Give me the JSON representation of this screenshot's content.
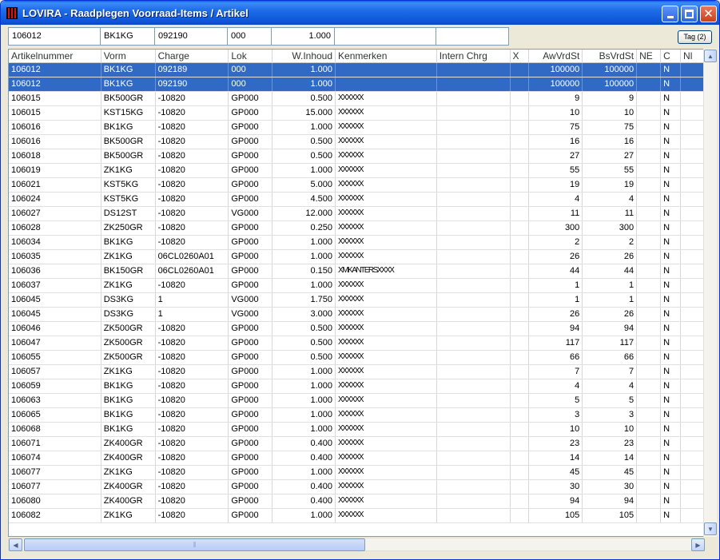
{
  "window": {
    "title": "LOVIRA - Raadplegen Voorraad-Items / Artikel"
  },
  "fields": [
    "106012",
    "BK1KG",
    "092190",
    "000",
    "1.000",
    "",
    ""
  ],
  "tag_button": "Tag (2)",
  "grid": {
    "columns": [
      {
        "key": "art",
        "label": "Artikelnummer",
        "align": "l"
      },
      {
        "key": "vorm",
        "label": "Vorm",
        "align": "l"
      },
      {
        "key": "charge",
        "label": "Charge",
        "align": "l"
      },
      {
        "key": "lok",
        "label": "Lok",
        "align": "l"
      },
      {
        "key": "wi",
        "label": "W.Inhoud",
        "align": "r"
      },
      {
        "key": "kenm",
        "label": "Kenmerken",
        "align": "l"
      },
      {
        "key": "ic",
        "label": "Intern Chrg",
        "align": "l"
      },
      {
        "key": "x",
        "label": "X",
        "align": "l"
      },
      {
        "key": "aw",
        "label": "AwVrdSt",
        "align": "r"
      },
      {
        "key": "bs",
        "label": "BsVrdSt",
        "align": "r"
      },
      {
        "key": "ne",
        "label": "NE",
        "align": "l"
      },
      {
        "key": "c",
        "label": "C",
        "align": "l"
      },
      {
        "key": "nl",
        "label": "Nl",
        "align": "l"
      }
    ],
    "rows": [
      [
        "106012",
        "BK1KG",
        "092189",
        "000",
        "1.000",
        "",
        "",
        "",
        "100000",
        "100000",
        "",
        "N",
        ""
      ],
      [
        "106012",
        "BK1KG",
        "092190",
        "000",
        "1.000",
        "",
        "",
        "",
        "100000",
        "100000",
        "",
        "N",
        ""
      ],
      [
        "106015",
        "BK500GR",
        "-10820",
        "GP000",
        "0.500",
        "XXXXXX",
        "",
        "",
        "9",
        "9",
        "",
        "N",
        ""
      ],
      [
        "106015",
        "KST15KG",
        "-10820",
        "GP000",
        "15.000",
        "XXXXXX",
        "",
        "",
        "10",
        "10",
        "",
        "N",
        ""
      ],
      [
        "106016",
        "BK1KG",
        "-10820",
        "GP000",
        "1.000",
        "XXXXXX",
        "",
        "",
        "75",
        "75",
        "",
        "N",
        ""
      ],
      [
        "106016",
        "BK500GR",
        "-10820",
        "GP000",
        "0.500",
        "XXXXXX",
        "",
        "",
        "16",
        "16",
        "",
        "N",
        ""
      ],
      [
        "106018",
        "BK500GR",
        "-10820",
        "GP000",
        "0.500",
        "XXXXXX",
        "",
        "",
        "27",
        "27",
        "",
        "N",
        ""
      ],
      [
        "106019",
        "ZK1KG",
        "-10820",
        "GP000",
        "1.000",
        "XXXXXX",
        "",
        "",
        "55",
        "55",
        "",
        "N",
        ""
      ],
      [
        "106021",
        "KST5KG",
        "-10820",
        "GP000",
        "5.000",
        "XXXXXX",
        "",
        "",
        "19",
        "19",
        "",
        "N",
        ""
      ],
      [
        "106024",
        "KST5KG",
        "-10820",
        "GP000",
        "4.500",
        "XXXXXX",
        "",
        "",
        "4",
        "4",
        "",
        "N",
        ""
      ],
      [
        "106027",
        "DS12ST",
        "-10820",
        "VG000",
        "12.000",
        "XXXXXX",
        "",
        "",
        "11",
        "11",
        "",
        "N",
        ""
      ],
      [
        "106028",
        "ZK250GR",
        "-10820",
        "GP000",
        "0.250",
        "XXXXXX",
        "",
        "",
        "300",
        "300",
        "",
        "N",
        ""
      ],
      [
        "106034",
        "BK1KG",
        "-10820",
        "GP000",
        "1.000",
        "XXXXXX",
        "",
        "",
        "2",
        "2",
        "",
        "N",
        ""
      ],
      [
        "106035",
        "ZK1KG",
        "06CL0260A01",
        "GP000",
        "1.000",
        "XXXXXX",
        "",
        "",
        "26",
        "26",
        "",
        "N",
        ""
      ],
      [
        "106036",
        "BK150GR",
        "06CL0260A01",
        "GP000",
        "0.150",
        "XMKANTERSXXXX",
        "",
        "",
        "44",
        "44",
        "",
        "N",
        ""
      ],
      [
        "106037",
        "ZK1KG",
        "-10820",
        "GP000",
        "1.000",
        "XXXXXX",
        "",
        "",
        "1",
        "1",
        "",
        "N",
        ""
      ],
      [
        "106045",
        "DS3KG",
        "1",
        "VG000",
        "1.750",
        "XXXXXX",
        "",
        "",
        "1",
        "1",
        "",
        "N",
        ""
      ],
      [
        "106045",
        "DS3KG",
        "1",
        "VG000",
        "3.000",
        "XXXXXX",
        "",
        "",
        "26",
        "26",
        "",
        "N",
        ""
      ],
      [
        "106046",
        "ZK500GR",
        "-10820",
        "GP000",
        "0.500",
        "XXXXXX",
        "",
        "",
        "94",
        "94",
        "",
        "N",
        ""
      ],
      [
        "106047",
        "ZK500GR",
        "-10820",
        "GP000",
        "0.500",
        "XXXXXX",
        "",
        "",
        "117",
        "117",
        "",
        "N",
        ""
      ],
      [
        "106055",
        "ZK500GR",
        "-10820",
        "GP000",
        "0.500",
        "XXXXXX",
        "",
        "",
        "66",
        "66",
        "",
        "N",
        ""
      ],
      [
        "106057",
        "ZK1KG",
        "-10820",
        "GP000",
        "1.000",
        "XXXXXX",
        "",
        "",
        "7",
        "7",
        "",
        "N",
        ""
      ],
      [
        "106059",
        "BK1KG",
        "-10820",
        "GP000",
        "1.000",
        "XXXXXX",
        "",
        "",
        "4",
        "4",
        "",
        "N",
        ""
      ],
      [
        "106063",
        "BK1KG",
        "-10820",
        "GP000",
        "1.000",
        "XXXXXX",
        "",
        "",
        "5",
        "5",
        "",
        "N",
        ""
      ],
      [
        "106065",
        "BK1KG",
        "-10820",
        "GP000",
        "1.000",
        "XXXXXX",
        "",
        "",
        "3",
        "3",
        "",
        "N",
        ""
      ],
      [
        "106068",
        "BK1KG",
        "-10820",
        "GP000",
        "1.000",
        "XXXXXX",
        "",
        "",
        "10",
        "10",
        "",
        "N",
        ""
      ],
      [
        "106071",
        "ZK400GR",
        "-10820",
        "GP000",
        "0.400",
        "XXXXXX",
        "",
        "",
        "23",
        "23",
        "",
        "N",
        ""
      ],
      [
        "106074",
        "ZK400GR",
        "-10820",
        "GP000",
        "0.400",
        "XXXXXX",
        "",
        "",
        "14",
        "14",
        "",
        "N",
        ""
      ],
      [
        "106077",
        "ZK1KG",
        "-10820",
        "GP000",
        "1.000",
        "XXXXXX",
        "",
        "",
        "45",
        "45",
        "",
        "N",
        ""
      ],
      [
        "106077",
        "ZK400GR",
        "-10820",
        "GP000",
        "0.400",
        "XXXXXX",
        "",
        "",
        "30",
        "30",
        "",
        "N",
        ""
      ],
      [
        "106080",
        "ZK400GR",
        "-10820",
        "GP000",
        "0.400",
        "XXXXXX",
        "",
        "",
        "94",
        "94",
        "",
        "N",
        ""
      ],
      [
        "106082",
        "ZK1KG",
        "-10820",
        "GP000",
        "1.000",
        "XXXXXX",
        "",
        "",
        "105",
        "105",
        "",
        "N",
        ""
      ]
    ],
    "selected_rows": [
      0,
      1
    ]
  },
  "scrollbars": {
    "up_icon": "scroll-up-arrow-icon",
    "down_icon": "scroll-down-arrow-icon",
    "left_icon": "scroll-left-arrow-icon",
    "right_icon": "scroll-right-arrow-icon"
  },
  "colors": {
    "titlebar": "#0A5FE0",
    "selection": "#316AC5",
    "window_bg": "#ECE9D8",
    "close_button": "#C8401C"
  }
}
